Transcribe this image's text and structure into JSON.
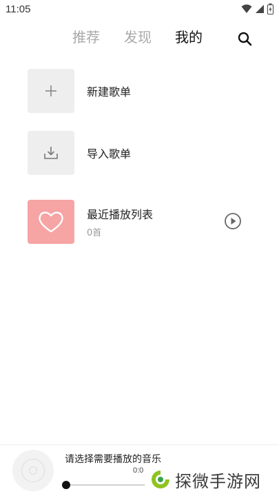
{
  "status": {
    "time": "11:05"
  },
  "tabs": [
    {
      "label": "推荐",
      "active": false
    },
    {
      "label": "发现",
      "active": false
    },
    {
      "label": "我的",
      "active": true
    }
  ],
  "items": [
    {
      "title": "新建歌单",
      "icon": "plus-icon"
    },
    {
      "title": "导入歌单",
      "icon": "import-icon"
    },
    {
      "title": "最近播放列表",
      "subtitle": "0首",
      "icon": "heart-icon"
    }
  ],
  "player": {
    "title": "请选择需要播放的音乐",
    "time": "0:0",
    "progress": 0
  },
  "watermark": {
    "text": "探微手游网"
  },
  "colors": {
    "favorite_bg": "#f6a4a4",
    "inactive_tab": "#a8a8a8",
    "active_tab": "#111111",
    "tile_bg": "#eeeeee"
  }
}
